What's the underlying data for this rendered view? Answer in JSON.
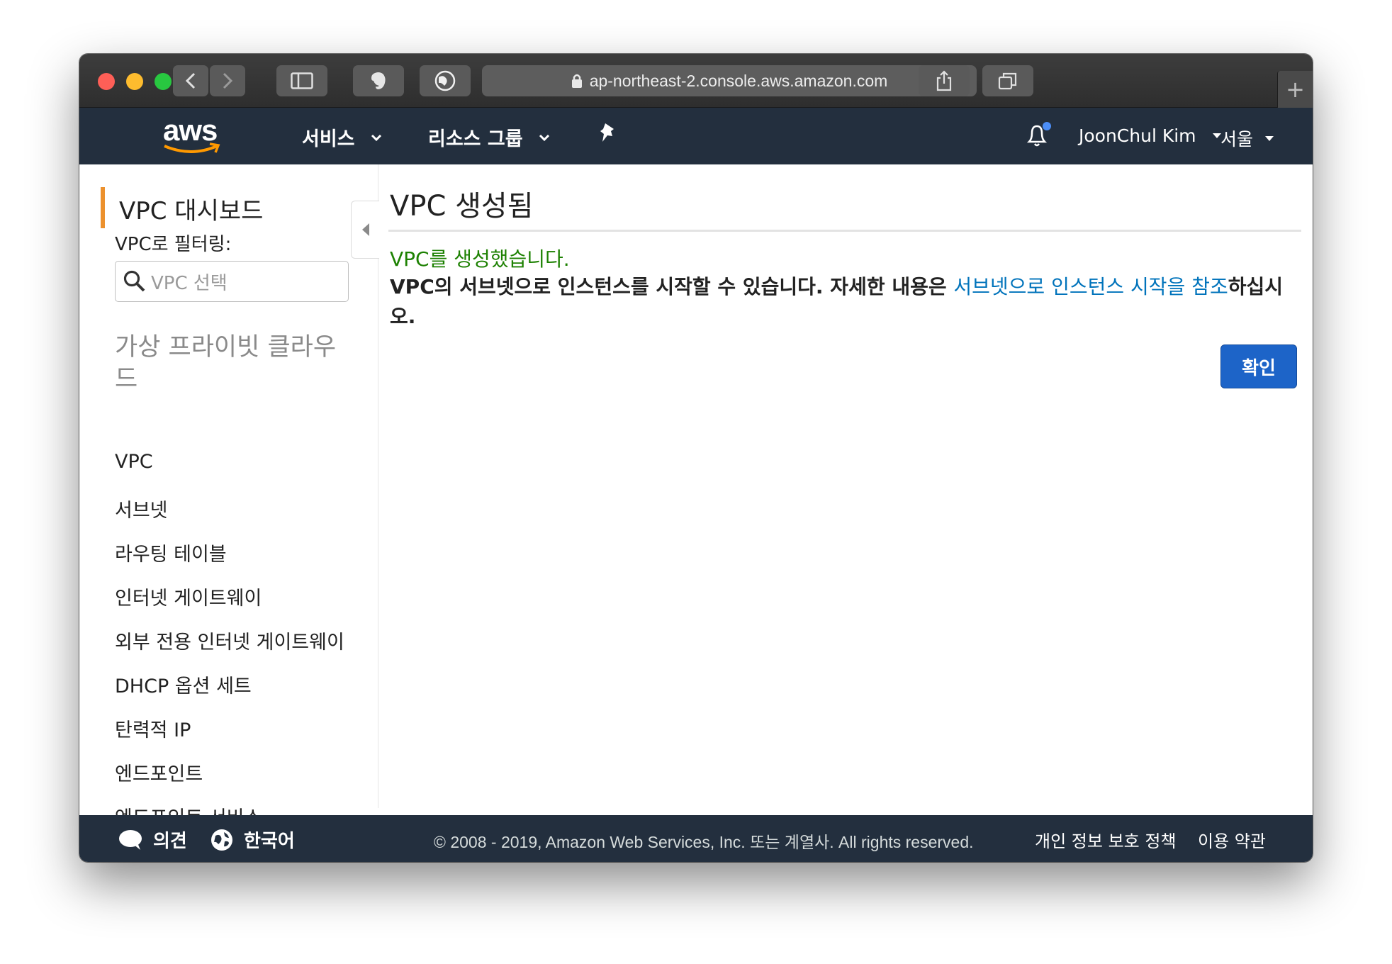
{
  "browser": {
    "url": "ap-northeast-2.console.aws.amazon.com"
  },
  "nav": {
    "logo": "aws",
    "services": "서비스",
    "resource_groups": "리소스 그룹",
    "user": "JoonChul Kim",
    "region": "서울"
  },
  "sidebar": {
    "title": "VPC 대시보드",
    "filter_label": "VPC로 필터링:",
    "search_placeholder": "VPC 선택",
    "section": "가상 프라이빗 클라우드",
    "items": [
      {
        "label": "VPC"
      },
      {
        "label": "서브넷"
      },
      {
        "label": "라우팅 테이블"
      },
      {
        "label": "인터넷 게이트웨이"
      },
      {
        "label": "외부 전용 인터넷 게이트웨이"
      },
      {
        "label": "DHCP 옵션 세트"
      },
      {
        "label": "탄력적 IP"
      },
      {
        "label": "엔드포인트"
      },
      {
        "label": "엔드포인트 서비스"
      }
    ]
  },
  "main": {
    "title": "VPC 생성됨",
    "success": "VPC를 생성했습니다.",
    "body_prefix": "VPC의 서브넷으로 인스턴스를 시작할 수 있습니다. 자세한 내용은 ",
    "body_link": "서브넷으로 인스턴스 시작을 참조",
    "body_suffix": "하십시오.",
    "confirm": "확인"
  },
  "footer": {
    "feedback": "의견",
    "language": "한국어",
    "copyright": "© 2008 - 2019, Amazon Web Services, Inc. 또는 계열사. All rights reserved.",
    "privacy": "개인 정보 보호 정책",
    "terms": "이용 약관"
  },
  "colors": {
    "nav_bg": "#232f3e",
    "accent": "#ec912d",
    "success": "#1d8102",
    "link": "#0073bb",
    "primary_button": "#1d64c8"
  }
}
